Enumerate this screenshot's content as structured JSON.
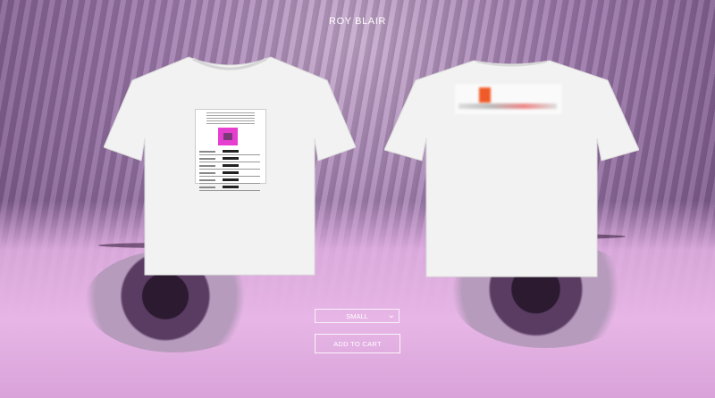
{
  "header": {
    "brand": "ROY BLAIR"
  },
  "product": {
    "images": [
      {
        "name": "front",
        "icon": "tshirt-front"
      },
      {
        "name": "back",
        "icon": "tshirt-back"
      }
    ],
    "size_select": {
      "value": "SMALL",
      "chevron": "chevron-down-icon"
    },
    "add_to_cart_label": "ADD TO CART"
  },
  "colors": {
    "background": "#9a7aa6",
    "text": "#ffffff",
    "accent_pink": "#e63fd0",
    "accent_orange": "#f05a28"
  }
}
